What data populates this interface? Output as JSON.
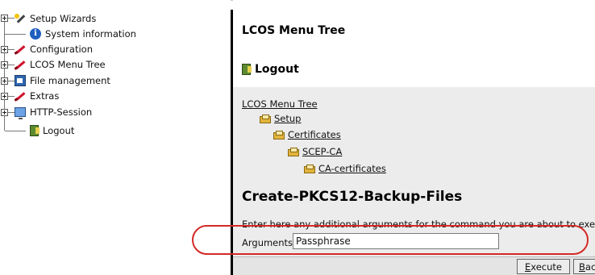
{
  "sidebar": {
    "items": [
      {
        "label": "Setup Wizards",
        "icon": "wand-icon",
        "expandable": true
      },
      {
        "label": "System information",
        "icon": "info-icon",
        "expandable": false
      },
      {
        "label": "Configuration",
        "icon": "pen-icon",
        "expandable": true
      },
      {
        "label": "LCOS Menu Tree",
        "icon": "pen-icon",
        "expandable": true
      },
      {
        "label": "File management",
        "icon": "file-icon",
        "expandable": true
      },
      {
        "label": "Extras",
        "icon": "pen-icon",
        "expandable": true
      },
      {
        "label": "HTTP-Session",
        "icon": "monitor-icon",
        "expandable": true
      },
      {
        "label": "Logout",
        "icon": "logout-icon",
        "expandable": false
      }
    ]
  },
  "main": {
    "title": "LCOS Menu Tree",
    "logout_label": "Logout",
    "breadcrumb": {
      "root": "LCOS Menu Tree",
      "items": [
        "Setup",
        "Certificates",
        "SCEP-CA",
        "CA-certificates"
      ]
    },
    "section_heading": "Create-PKCS12-Backup-Files",
    "description": "Enter here any additional arguments for the command you are about to execute",
    "arguments": {
      "label": "Arguments",
      "value": "Passphrase"
    },
    "buttons": {
      "execute_first": "E",
      "execute_rest": "xecute",
      "back_first": "B",
      "back_rest": "ack"
    }
  },
  "colors": {
    "highlight": "#d32a25",
    "panel_grey": "#ececec",
    "divider": "#000000"
  }
}
